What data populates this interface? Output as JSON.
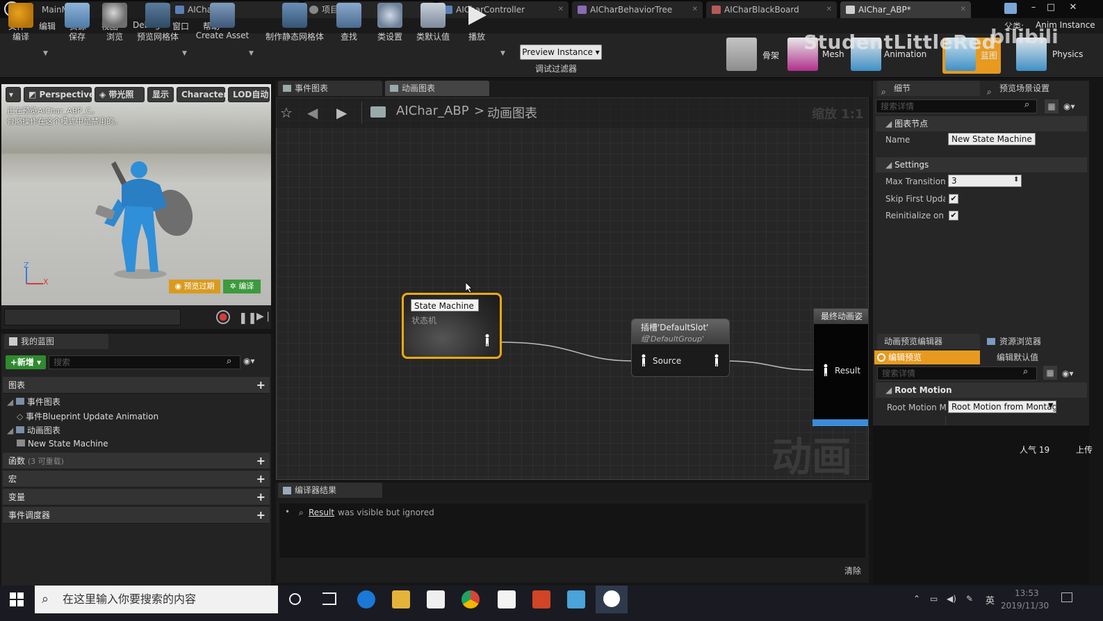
{
  "titlebar": {
    "tabs": [
      {
        "label": "MainMap"
      },
      {
        "label": "AIChar"
      },
      {
        "label": "项目设置"
      },
      {
        "label": "AICharController"
      },
      {
        "label": "AICharBehaviorTree"
      },
      {
        "label": "AICharBlackBoard"
      },
      {
        "label": "AIChar_ABP*"
      }
    ],
    "window_buttons": [
      "–",
      "□",
      "✕"
    ]
  },
  "menu": [
    "文件",
    "编辑",
    "资源",
    "视图",
    "Debug",
    "窗口",
    "帮助"
  ],
  "toolbar": {
    "tools": [
      "编译",
      "保存",
      "浏览",
      "预览网格体",
      "Create Asset",
      "制作静态网格体",
      "查找",
      "类设置",
      "类默认值",
      "播放"
    ],
    "preview_instance": "Preview Instance",
    "debug_filter": "调试过滤器",
    "modes": [
      "骨架",
      "Mesh",
      "Animation",
      "蓝图",
      "Physics"
    ],
    "anim_instance": "Anim Instance",
    "anim_instance_prefix": "父类:"
  },
  "watermark": {
    "text": "StudentLittleRed",
    "text2": "bilibili"
  },
  "viewport": {
    "buttons": [
      "Perspective",
      "带光照",
      "显示",
      "Character",
      "LOD自动"
    ],
    "info_line1": "正在预览AIChar_ABP_C。",
    "info_line2": "骨骼操作在这个模式中是禁用的。",
    "axis_z": "Z",
    "axis_x": "X",
    "preview_expired": "预览过期",
    "compile": "编译"
  },
  "my_blueprint": {
    "tab": "我的蓝图",
    "new_button": "+新增",
    "search_placeholder": "搜索",
    "sections": {
      "graphs": "图表",
      "functions": "函数",
      "functions_hint": "(3 可重载)",
      "macros": "宏",
      "variables": "变量",
      "dispatchers": "事件调度器"
    },
    "tree": {
      "event_graph": "事件图表",
      "event_bp_update": "事件Blueprint Update Animation",
      "anim_graph": "动画图表",
      "new_state_machine": "New State Machine"
    }
  },
  "graph": {
    "tabs": [
      "事件图表",
      "动画图表"
    ],
    "breadcrumb_root": "AIChar_ABP",
    "breadcrumb_sep": ">",
    "breadcrumb_leaf": "动画图表",
    "zoom": "缩放 1:1",
    "watermark": "动画",
    "nodes": {
      "state_machine_title": "State Machine",
      "state_machine_sub": "状态机",
      "slot_title": "插槽'DefaultSlot'",
      "slot_group": "组'DefaultGroup'",
      "slot_source": "Source",
      "final_title": "最终动画姿",
      "final_result": "Result"
    }
  },
  "compiler": {
    "tab": "编译器结果",
    "msg_bullet": "•",
    "msg_target": "Result",
    "msg_text": "was visible but ignored",
    "clear": "清除"
  },
  "details": {
    "tab_details": "细节",
    "tab_preview_scene": "预览场景设置",
    "search_placeholder": "搜索详情",
    "section_node": "图表节点",
    "name_label": "Name",
    "name_value": "New State Machine",
    "section_settings": "Settings",
    "max_transitions_label": "Max Transitions",
    "max_transitions_value": "3",
    "skip_first_label": "Skip First Update",
    "skip_first_checked": true,
    "reinit_label": "Reinitialize on Entry",
    "reinit_checked": true
  },
  "anim_preview": {
    "tab_editor": "动画预览编辑器",
    "tab_assets": "资源浏览器",
    "edit_preview": "编辑预览",
    "edit_defaults": "编辑默认值",
    "search_placeholder": "搜索详情",
    "section_root_motion": "Root Motion",
    "root_motion_label": "Root Motion Mode",
    "root_motion_value": "Root Motion from Montage",
    "popularity": "人气 19",
    "upload": "上传"
  },
  "taskbar": {
    "search_placeholder": "在这里输入你要搜索的内容",
    "ime": "英",
    "time": "13:53",
    "date": "2019/11/30"
  }
}
